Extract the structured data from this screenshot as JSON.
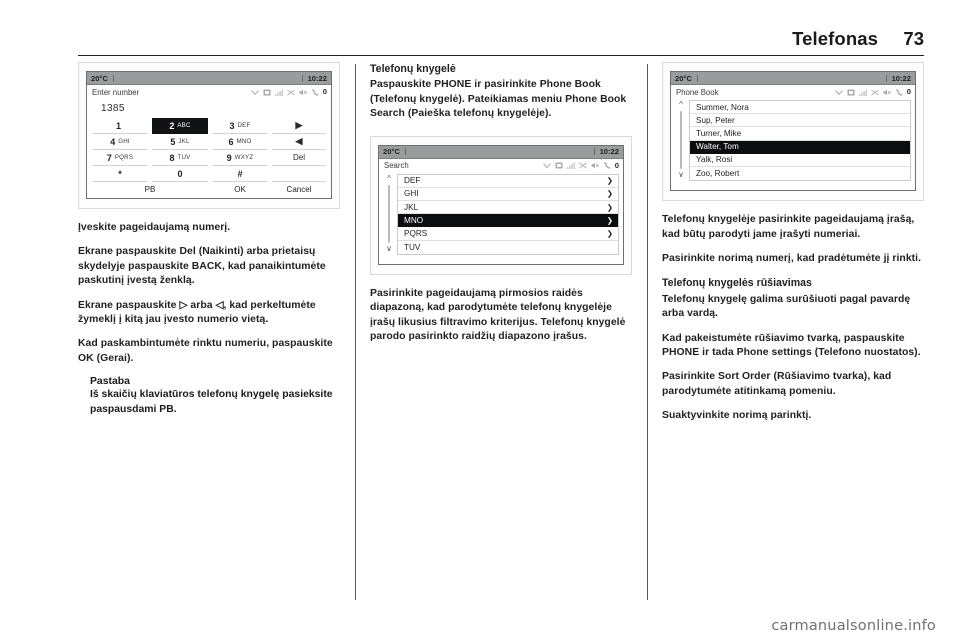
{
  "header": {
    "title": "Telefonas",
    "page_number": "73"
  },
  "watermark": "carmanualsonline.info",
  "screens": {
    "keypad": {
      "temperature": "20°C",
      "clock": "10:22",
      "title": "Enter number",
      "entered_number": "1385",
      "status_count": "0",
      "keys": [
        {
          "big": "1",
          "small": ""
        },
        {
          "big": "2",
          "small": "ABC"
        },
        {
          "big": "3",
          "small": "DEF"
        },
        {
          "big": "▶",
          "small": ""
        },
        {
          "big": "4",
          "small": "GHI"
        },
        {
          "big": "5",
          "small": "JKL"
        },
        {
          "big": "6",
          "small": "MNO"
        },
        {
          "big": "◀",
          "small": ""
        },
        {
          "big": "7",
          "small": "PQRS"
        },
        {
          "big": "8",
          "small": "TUV"
        },
        {
          "big": "9",
          "small": "WXYZ"
        },
        {
          "big": "Del",
          "small": ""
        },
        {
          "big": "*",
          "small": ""
        },
        {
          "big": "0",
          "small": ""
        },
        {
          "big": "#",
          "small": ""
        },
        {
          "big": "",
          "small": ""
        }
      ],
      "selected_key_index": 1,
      "footer": {
        "pb": "PB",
        "ok": "OK",
        "cancel": "Cancel"
      }
    },
    "search": {
      "temperature": "20°C",
      "clock": "10:22",
      "title": "Search",
      "status_count": "0",
      "items": [
        {
          "label": "DEF",
          "chevron": "❯"
        },
        {
          "label": "GHI",
          "chevron": "❯"
        },
        {
          "label": "JKL",
          "chevron": "❯"
        },
        {
          "label": "MNO",
          "chevron": "❯"
        },
        {
          "label": "PQRS",
          "chevron": "❯"
        },
        {
          "label": "TUV",
          "chevron": ""
        }
      ],
      "selected_index": 3
    },
    "phonebook": {
      "temperature": "20°C",
      "clock": "10:22",
      "title": "Phone Book",
      "status_count": "0",
      "items": [
        {
          "label": "Summer, Nora"
        },
        {
          "label": "Sup, Peter"
        },
        {
          "label": "Turner, Mike"
        },
        {
          "label": "Walter, Tom"
        },
        {
          "label": "Yalk, Rosi"
        },
        {
          "label": "Zoo, Robert"
        }
      ],
      "selected_index": 3
    }
  },
  "column1": {
    "p1": "Įveskite pageidaujamą numerį.",
    "p2": "Ekrane paspauskite Del (Naikinti) arba prietaisų skydelyje paspauskite BACK, kad panaikintumėte paskutinį įvestą ženklą.",
    "p3": "Ekrane paspauskite ▷ arba ◁, kad perkeltumėte žymeklį į kitą jau įvesto numerio vietą.",
    "p4": "Kad paskambintumėte rinktu numeriu, paspauskite OK (Gerai).",
    "note_title": "Pastaba",
    "note_text": "Iš skaičių klaviatūros telefonų knygelę pasieksite paspausdami PB."
  },
  "column2": {
    "heading": "Telefonų knygelė",
    "p1": "Paspauskite PHONE ir pasirinkite Phone Book (Telefonų knygelė). Pateikiamas meniu Phone Book Search (Paieška telefonų knygelėje).",
    "p2": "Pasirinkite pageidaujamą pirmosios raidės diapazoną, kad parodytumėte telefonų knygelėje įrašų likusius filtravimo kriterijus. Telefonų knygelė parodo pasirinkto raidžių diapazono įrašus."
  },
  "column3": {
    "p1": "Telefonų knygelėje pasirinkite pageidaujamą įrašą, kad būtų parodyti jame įrašyti numeriai.",
    "p2": "Pasirinkite norimą numerį, kad pradėtumėte jį rinkti.",
    "heading": "Telefonų knygelės rūšiavimas",
    "p3": "Telefonų knygelę galima surūšiuoti pagal pavardę arba vardą.",
    "p4": "Kad pakeistumėte rūšiavimo tvarką, paspauskite PHONE ir tada Phone settings (Telefono nuostatos).",
    "p5": "Pasirinkite Sort Order (Rūšiavimo tvarka), kad parodytumėte atitinkamą pomeniu.",
    "p6": "Suaktyvinkite norimą parinktį."
  }
}
